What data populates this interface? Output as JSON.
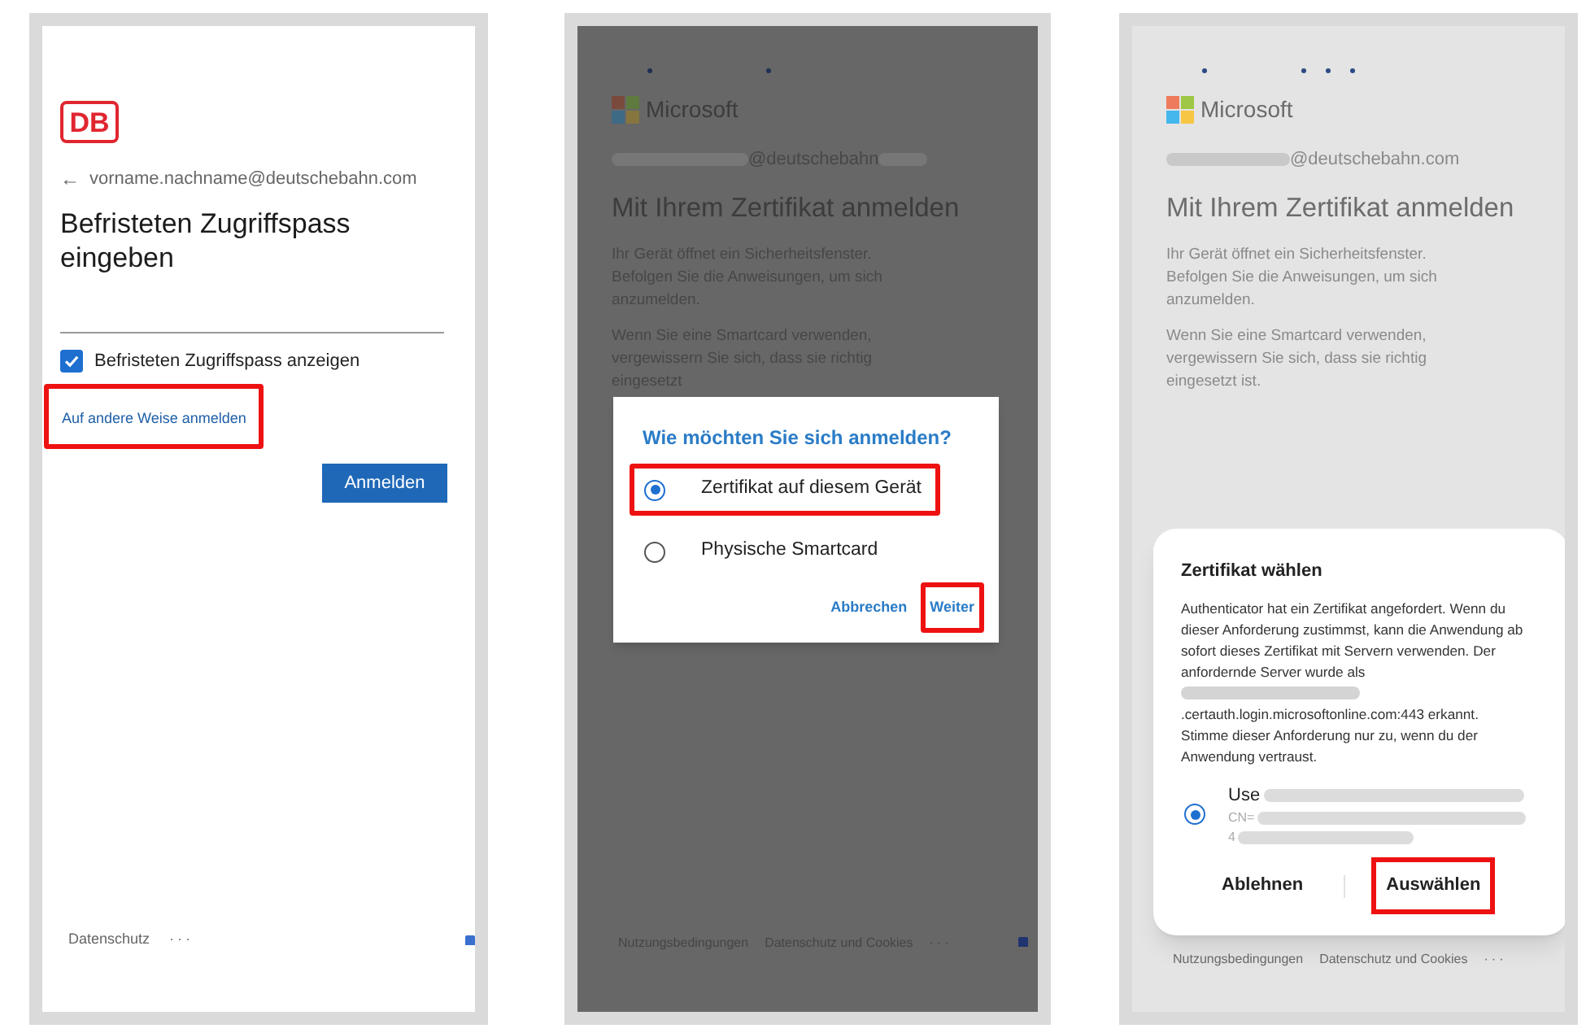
{
  "screen_1": {
    "logo": "DB",
    "back": "←",
    "email": "vorname.nachname@deutschebahn.com",
    "heading": "Befristeten Zugriffspass eingeben",
    "show_pass": {
      "label": "Befristeten Zugriffspass anzeigen",
      "checked": true
    },
    "other_way_link": {
      "label": "Auf andere Weise anmelden",
      "highlighted": true
    },
    "submit": "Anmelden",
    "footer": [
      "Datenschutz",
      "···"
    ]
  },
  "screen_2": {
    "brand": "Microsoft",
    "email_domain": "@deutschebahn",
    "heading": "Mit Ihrem Zertifikat anmelden",
    "paragraphs": [
      "Ihr Gerät öffnet ein Sicherheitsfenster. Befolgen Sie die Anweisungen, um sich anzumelden.",
      "Wenn Sie eine Smartcard verwenden, vergewissern Sie sich, dass sie richtig eingesetzt"
    ],
    "dialog": {
      "title": "Wie möchten Sie sich anmelden?",
      "options": [
        {
          "label": "Zertifikat auf diesem Gerät",
          "selected": true,
          "highlighted": true
        },
        {
          "label": "Physische Smartcard",
          "selected": false,
          "highlighted": false
        }
      ],
      "buttons": [
        {
          "label": "Abbrechen",
          "highlighted": false
        },
        {
          "label": "Weiter",
          "highlighted": true
        }
      ]
    },
    "footer": [
      "Nutzungsbedingungen",
      "Datenschutz und Cookies",
      "···"
    ]
  },
  "screen_3": {
    "brand": "Microsoft",
    "email_domain": "@deutschebahn.com",
    "heading": "Mit Ihrem Zertifikat anmelden",
    "paragraphs": [
      "Ihr Gerät öffnet ein Sicherheitsfenster. Befolgen Sie die Anweisungen, um sich anzumelden.",
      "Wenn Sie eine Smartcard verwenden, vergewissern Sie sich, dass sie richtig eingesetzt ist."
    ],
    "dialog": {
      "title": "Zertifikat wählen",
      "message_before": "Authenticator hat ein Zertifikat angefordert. Wenn du dieser Anforderung zustimmst, kann die Anwendung ab sofort dieses Zertifikat mit Servern verwenden. Der anfordernde Server wurde als",
      "message_after": ".certauth.login.microsoftonline.com:443 erkannt. Stimme dieser Anforderung nur zu, wenn du der Anwendung vertraust.",
      "certificate": {
        "selected": true,
        "lines": [
          "Use",
          "CN=",
          "4"
        ]
      },
      "buttons": [
        {
          "label": "Ablehnen",
          "highlighted": false
        },
        {
          "label": "Auswählen",
          "highlighted": true
        }
      ]
    },
    "footer": [
      "Nutzungsbedingungen",
      "Datenschutz und Cookies",
      "···"
    ]
  }
}
